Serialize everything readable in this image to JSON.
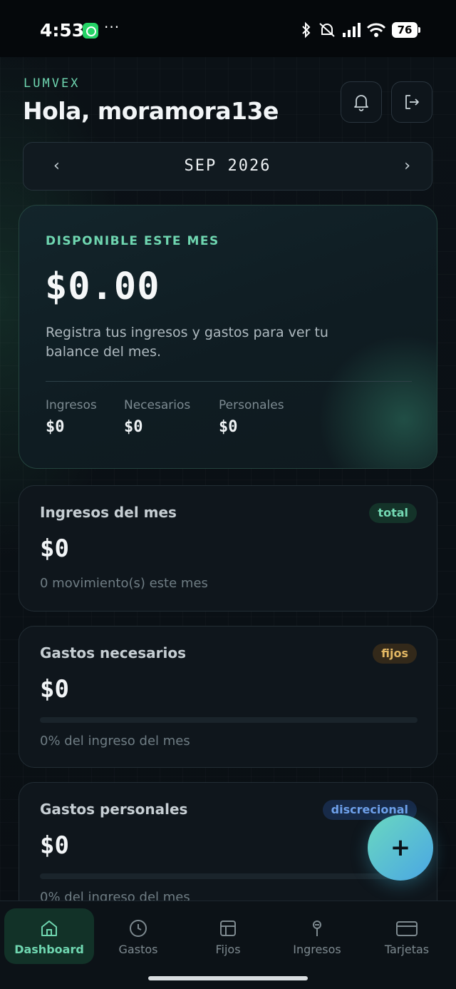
{
  "status_bar": {
    "time": "4:53",
    "dots": "···",
    "battery": "76"
  },
  "header": {
    "brand": "LUMVEX",
    "greeting": "Hola, moramora13e"
  },
  "month": {
    "prev": "‹",
    "label": "SEP 2026",
    "next": "›"
  },
  "balance": {
    "label": "DISPONIBLE ESTE MES",
    "amount": "$0.00",
    "description": "Registra tus ingresos y gastos para ver tu balance del mes.",
    "stats": [
      {
        "label": "Ingresos",
        "value": "$0"
      },
      {
        "label": "Necesarios",
        "value": "$0"
      },
      {
        "label": "Personales",
        "value": "$0"
      }
    ]
  },
  "cards": [
    {
      "title": "Ingresos del mes",
      "badge": "total",
      "amount": "$0",
      "note": "0 movimiento(s) este mes"
    },
    {
      "title": "Gastos necesarios",
      "badge": "fijos",
      "amount": "$0",
      "progress": 0,
      "note": "0% del ingreso del mes"
    },
    {
      "title": "Gastos personales",
      "badge": "discrecional",
      "amount": "$0",
      "progress": 0,
      "note": "0% del ingreso del mes"
    }
  ],
  "fab": {
    "label": "+"
  },
  "nav": [
    {
      "label": "Dashboard",
      "icon": "home-icon",
      "active": true
    },
    {
      "label": "Gastos",
      "icon": "clock-icon",
      "active": false
    },
    {
      "label": "Fijos",
      "icon": "grid-icon",
      "active": false
    },
    {
      "label": "Ingresos",
      "icon": "pin-icon",
      "active": false
    },
    {
      "label": "Tarjetas",
      "icon": "card-icon",
      "active": false
    }
  ],
  "colors": {
    "accent": "#6fd6b0",
    "background": "#0a0f14",
    "fijos": "#e2b763",
    "discrecional": "#6ea0ea"
  }
}
